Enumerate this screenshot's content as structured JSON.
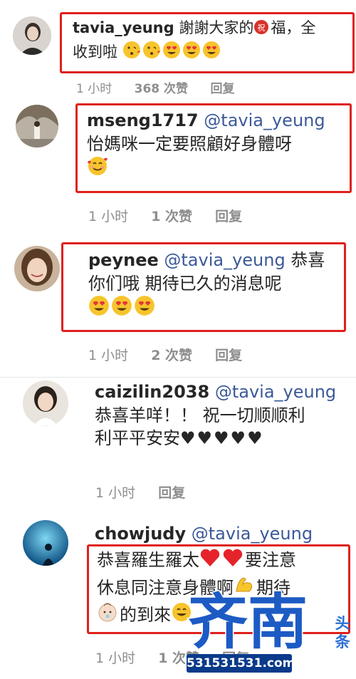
{
  "comments": [
    {
      "user": "tavia_yeung",
      "mention": "",
      "text_line1": "謝謝大家的",
      "text_line1b": "福，全",
      "text_line2": "收到啦",
      "time": "1 小时",
      "likes": "368 次赞",
      "reply": "回复"
    },
    {
      "user": "mseng1717",
      "mention": "@tavia_yeung",
      "text_line1": "怡媽咪一定要照顧好身體呀",
      "time": "1 小时",
      "likes": "1 次赞",
      "reply": "回复"
    },
    {
      "user": "peynee",
      "mention": "@tavia_yeung",
      "text_line0": "恭喜",
      "text_line1": "你们哦 期待已久的消息呢",
      "time": "1 小时",
      "likes": "2 次赞",
      "reply": "回复"
    },
    {
      "user": "caizilin2038",
      "mention": "@tavia_yeung",
      "text_line1": "恭喜羊咩！！ 祝一切顺顺利",
      "text_line2": "利平平安安",
      "hearts": "♥♥♥♥♥",
      "time": "1 小时",
      "reply": "回复"
    },
    {
      "user": "chowjudy",
      "mention": "@tavia_yeung",
      "text_line1": "恭喜羅生羅太",
      "text_line1b": "要注意",
      "text_line2": "休息同注意身體啊",
      "text_line2b": "期待",
      "text_line3": "的到來",
      "time": "1 小时",
      "likes": "1 次赞",
      "reply": "回复"
    }
  ],
  "blessing_badge": "祝",
  "watermark": {
    "logo": "齐南",
    "side": "头条",
    "url": "531531531.com"
  },
  "colors": {
    "highlight_box": "#e0201c",
    "mention": "#3b5998",
    "meta": "#8e8e8e"
  }
}
